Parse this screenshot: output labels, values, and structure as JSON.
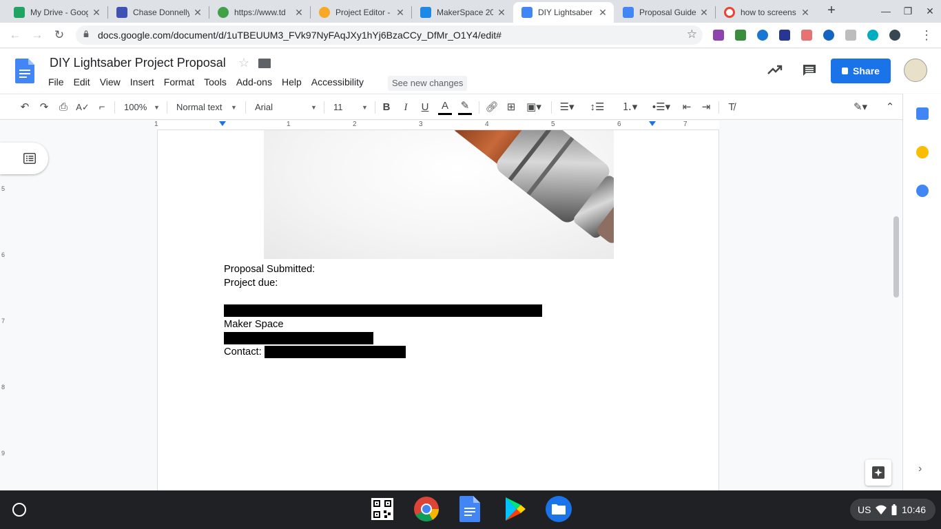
{
  "browser": {
    "tabs": [
      {
        "title": "My Drive - Goog",
        "favicon_color": "#1fa463"
      },
      {
        "title": "Chase Donnelly",
        "favicon_color": "#3f51b5"
      },
      {
        "title": "https://www.td",
        "favicon_color": "#43a047"
      },
      {
        "title": "Project Editor -",
        "favicon_color": "#f9a825"
      },
      {
        "title": "MakerSpace 20",
        "favicon_color": "#1e88e5"
      },
      {
        "title": "DIY Lightsaber",
        "favicon_color": "#4285f4"
      },
      {
        "title": "Proposal Guide",
        "favicon_color": "#4285f4"
      },
      {
        "title": "how to screens",
        "favicon_color": "#ea4335"
      }
    ],
    "active_tab_index": 5,
    "url": "docs.google.com/document/d/1uTBEUUM3_FVk97NyFAqJXy1hYj6BzaCCy_DfMr_O1Y4/edit#"
  },
  "docs": {
    "title": "DIY Lightsaber Project Proposal",
    "menu": [
      "File",
      "Edit",
      "View",
      "Insert",
      "Format",
      "Tools",
      "Add-ons",
      "Help",
      "Accessibility"
    ],
    "see_new_changes": "See new changes",
    "share_label": "Share",
    "toolbar": {
      "zoom": "100%",
      "style": "Normal text",
      "font": "Arial",
      "font_size": "11"
    },
    "ruler_numbers": [
      "1",
      "1",
      "2",
      "3",
      "4",
      "5",
      "6",
      "7"
    ],
    "vertical_ruler_numbers": [
      "5",
      "6",
      "7",
      "8",
      "9"
    ],
    "body": {
      "proposal_submitted": "Proposal Submitted:",
      "project_due": "Project due:",
      "maker_space": "Maker Space",
      "contact": "Contact:"
    }
  },
  "shelf": {
    "locale": "US",
    "time": "10:46"
  },
  "colors": {
    "accent": "#1a73e8",
    "docs_blue": "#4285f4"
  }
}
